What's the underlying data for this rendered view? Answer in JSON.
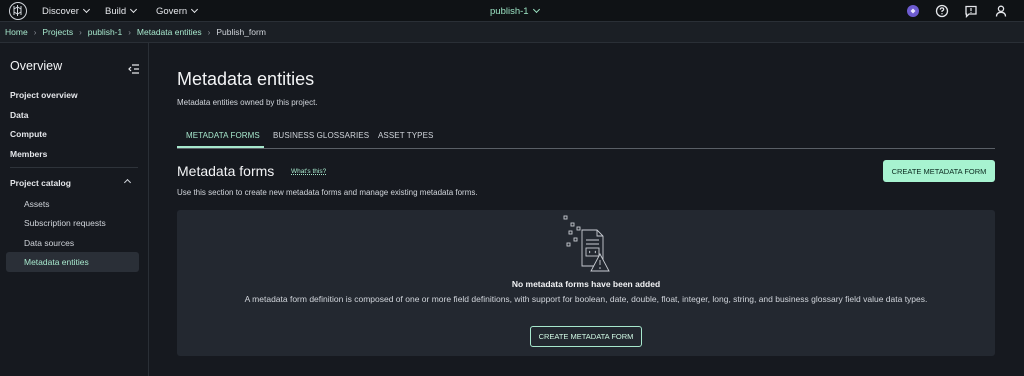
{
  "topnav": {
    "menus": [
      "Discover",
      "Build",
      "Govern"
    ],
    "project": "publish-1"
  },
  "breadcrumb": [
    "Home",
    "Projects",
    "publish-1",
    "Metadata entities",
    "Publish_form"
  ],
  "sidebar": {
    "title": "Overview",
    "items": [
      "Project overview",
      "Data",
      "Compute",
      "Members"
    ],
    "catalog_label": "Project catalog",
    "catalog_items": [
      "Assets",
      "Subscription requests",
      "Data sources"
    ],
    "active_item": "Metadata entities"
  },
  "main": {
    "title": "Metadata entities",
    "description": "Metadata entities owned by this project.",
    "tabs": [
      "METADATA FORMS",
      "BUSINESS GLOSSARIES",
      "ASSET TYPES"
    ],
    "section_title": "Metadata forms",
    "whats_this": "What's this?",
    "section_description": "Use this section to create new metadata forms and manage existing metadata forms.",
    "create_button": "CREATE METADATA FORM",
    "empty_title": "No metadata forms have been added",
    "empty_description": "A metadata form definition is composed of one or more field definitions, with support for boolean, date, double, float, integer, long, string, and business glossary field value data types.",
    "empty_button": "CREATE METADATA FORM"
  },
  "colors": {
    "accent": "#a7e8cd",
    "primary_button": "#a7f3d0",
    "background": "#16191f",
    "panel": "#232830"
  },
  "icons": [
    "logo-icon",
    "chevron-down-icon",
    "ai-assistant-icon",
    "help-icon",
    "feedback-icon",
    "user-icon",
    "collapse-sidebar-icon",
    "caret-up-icon",
    "empty-forms-illustration-icon"
  ]
}
